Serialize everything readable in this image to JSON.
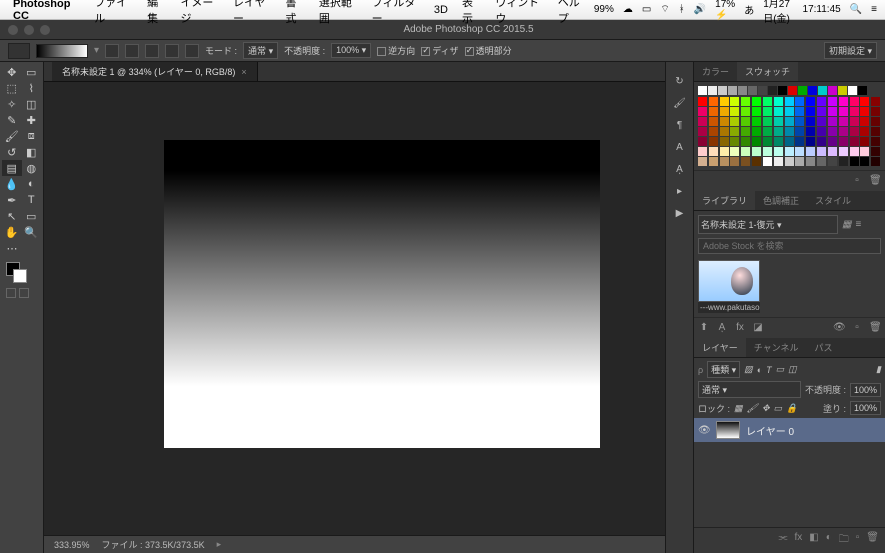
{
  "menubar": {
    "apple": "",
    "app": "Photoshop CC",
    "items": [
      "ファイル",
      "編集",
      "イメージ",
      "レイヤー",
      "書式",
      "選択範囲",
      "フィルター",
      "3D",
      "表示",
      "ウィンドウ",
      "ヘルプ"
    ],
    "battery": "17%",
    "date": "1月27日(金)",
    "time": "17:11:45"
  },
  "titlebar": {
    "title": "Adobe Photoshop CC 2015.5"
  },
  "optbar": {
    "mode_lbl": "モード :",
    "mode_val": "通常",
    "opacity_lbl": "不透明度 :",
    "opacity_val": "100%",
    "reverse": "逆方向",
    "dither": "ディザ",
    "trans": "透明部分",
    "preset": "初期設定"
  },
  "doc": {
    "tab": "名称未設定 1 @ 334% (レイヤー 0, RGB/8)",
    "zoom": "333.95%",
    "file": "ファイル : 373.5K/373.5K"
  },
  "panels": {
    "color_tab": "カラー",
    "swatch_tab": "スウォッチ",
    "lib_tab": "ライブラリ",
    "adjust_tab": "色調補正",
    "style_tab": "スタイル",
    "lib_sel": "名称未設定 1-復元",
    "search_ph": "Adobe Stock を検索",
    "thumb_lbl": "---www.pakutaso....",
    "layers_tab": "レイヤー",
    "channels_tab": "チャンネル",
    "paths_tab": "パス",
    "filter_kind": "種類",
    "blend": "通常",
    "opacity_lbl": "不透明度 :",
    "opacity_val": "100%",
    "lock_lbl": "ロック :",
    "fill_lbl": "塗り :",
    "fill_val": "100%",
    "layer0": "レイヤー 0"
  },
  "grays": [
    "#fff",
    "#eee",
    "#ccc",
    "#aaa",
    "#888",
    "#666",
    "#444",
    "#222",
    "#000",
    "#d00",
    "#0a0",
    "#00d",
    "#0cc",
    "#c0c",
    "#cc0",
    "#fff",
    "#000"
  ],
  "colors": [
    "#ff0000",
    "#ff6600",
    "#ffcc00",
    "#ccff00",
    "#66ff00",
    "#00ff00",
    "#00ff66",
    "#00ffcc",
    "#00ccff",
    "#0066ff",
    "#0000ff",
    "#6600ff",
    "#cc00ff",
    "#ff00cc",
    "#ff0066",
    "#ff0000",
    "#800",
    "#e06",
    "#e60",
    "#ea0",
    "#ce0",
    "#6e0",
    "#0e0",
    "#0e6",
    "#0ec",
    "#0ce",
    "#06e",
    "#00e",
    "#60e",
    "#c0e",
    "#e0c",
    "#e06",
    "#e00",
    "#700",
    "#c05",
    "#c50",
    "#c80",
    "#ac0",
    "#5c0",
    "#0c0",
    "#0c5",
    "#0ca",
    "#0ac",
    "#05c",
    "#00c",
    "#50c",
    "#a0c",
    "#c0a",
    "#c05",
    "#c00",
    "#600",
    "#a04",
    "#a40",
    "#a70",
    "#8a0",
    "#4a0",
    "#0a0",
    "#0a4",
    "#0a8",
    "#08a",
    "#04a",
    "#00a",
    "#40a",
    "#80a",
    "#a08",
    "#a04",
    "#a00",
    "#500",
    "#803",
    "#830",
    "#860",
    "#680",
    "#380",
    "#080",
    "#083",
    "#086",
    "#068",
    "#038",
    "#008",
    "#308",
    "#608",
    "#806",
    "#803",
    "#800",
    "#400",
    "#fcc",
    "#fdb",
    "#fea",
    "#efb",
    "#cfb",
    "#bfc",
    "#bfd",
    "#bfe",
    "#bef",
    "#bdf",
    "#bcf",
    "#cbf",
    "#dbf",
    "#ecf",
    "#fce",
    "#fcd",
    "#300",
    "#d4b090",
    "#caa070",
    "#b89060",
    "#9a7040",
    "#7a5020",
    "#5a3000",
    "#fff",
    "#eee",
    "#ccc",
    "#aaa",
    "#888",
    "#666",
    "#444",
    "#222",
    "#000",
    "#000",
    "#200"
  ]
}
